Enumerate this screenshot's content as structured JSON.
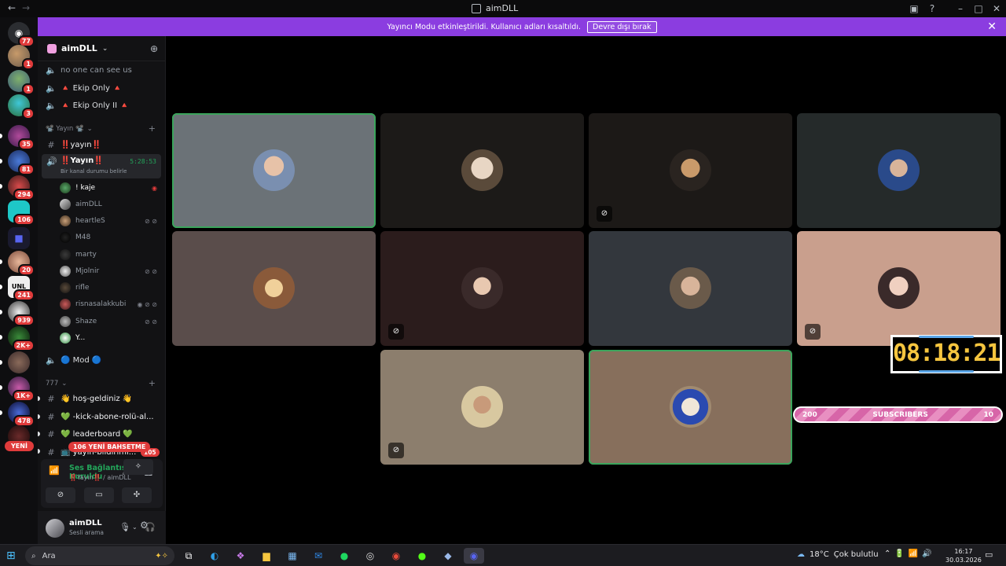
{
  "window": {
    "title": "aimDLL"
  },
  "banner": {
    "text": "Yayıncı Modu etkinleştirildi. Kullanıcı adları kısaltıldı.",
    "button": "Devre dışı bırak"
  },
  "rail": {
    "badges": [
      "77",
      "1",
      "1",
      "3",
      "35",
      "81",
      "294",
      "106",
      "20",
      "241",
      "939",
      "2K+",
      "1K+",
      "478"
    ],
    "new_label": "YENİ"
  },
  "guild": {
    "name": "aimDLL"
  },
  "channels": {
    "top": [
      {
        "name": "no one can see us"
      },
      {
        "name": "🔺 Ekip Only 🔺"
      },
      {
        "name": "🔺 Ekip Only II 🔺"
      }
    ],
    "cat_yayin": "📽️ Yayın 📽️",
    "yayin_text": "‼️yayın‼️",
    "yayin_voice": "‼️Yayın‼️",
    "yayin_voice_timer": "5:28:53",
    "yayin_voice_status": "Bir kanal durumu belirle",
    "voice_users": [
      {
        "name": "! kaje"
      },
      {
        "name": "aimDLL"
      },
      {
        "name": "heartleS"
      },
      {
        "name": "M48"
      },
      {
        "name": "marty"
      },
      {
        "name": "Mjolnir"
      },
      {
        "name": "rifle"
      },
      {
        "name": "risnasalakkubi"
      },
      {
        "name": "Shaze"
      },
      {
        "name": "Y..."
      }
    ],
    "mod": "🔵 Mod 🔵",
    "cat_777": "777",
    "list777": [
      {
        "name": "👋 hoş-geldiniz 👋"
      },
      {
        "name": "💚 -kick-abone-rolü-al..."
      },
      {
        "name": "💚 leaderboard 💚"
      },
      {
        "name": "📺 yayın-bildirimi..."
      }
    ],
    "mention_pill": "106 YENİ BAHSETME",
    "last_badge": "105"
  },
  "voice_panel": {
    "status": "Ses Bağlantısı Kuruldu",
    "sub": "‼️Yayın‼️ / aimDLL"
  },
  "user": {
    "name": "aimDLL",
    "status": "Sesli arama"
  },
  "overlay": {
    "timer": "08:18:21",
    "sub_left": "200",
    "sub_label": "SUBSCRIBERS",
    "sub_right": "10"
  },
  "taskbar": {
    "search": "Ara",
    "weather_temp": "18°C",
    "weather_text": "Çok bulutlu",
    "time": "16:17",
    "date": "30.03.2026"
  },
  "colors": {
    "accent": "#8b3de0",
    "speaking": "#3ba55c",
    "badge": "#e03b3b",
    "timer_text": "#f5c53f"
  }
}
